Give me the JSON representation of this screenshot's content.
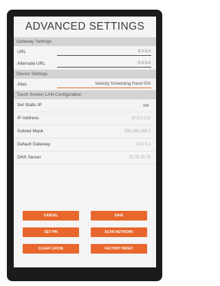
{
  "title": "ADVANCED SETTINGS",
  "gateway": {
    "header": "Gateway Settings",
    "url_label": "URL",
    "url_value": "0.0.0.0",
    "alt_url_label": "Alternate URL",
    "alt_url_value": "0.0.0.0"
  },
  "device": {
    "header": "Device Settings",
    "alias_label": "Alias",
    "alias_value": "Velocity Scheduling Panel 000"
  },
  "lan": {
    "header": "Touch Screen LAN Configuration",
    "static_ip_label": "Set Static IP",
    "ip_label": "IP Address",
    "ip_value": "10.0.0.123",
    "mask_label": "Subnet Mask",
    "mask_value": "255.255.255.0",
    "gateway_label": "Default Gateway",
    "gateway_value": "10.0.0.1",
    "dns_label": "DNS Server",
    "dns_value": "75.75.75.75"
  },
  "buttons": {
    "cancel": "CANCEL",
    "save": "SAVE",
    "set_pin": "SET PIN",
    "scan_network": "SCAN NETWORK",
    "clear_cache": "CLEAR CACHE",
    "factory_reset": "FACTORY RESET"
  },
  "colors": {
    "accent": "#e8672c",
    "section_bg": "#d4d4d4",
    "bezel": "#1b1b1b"
  }
}
